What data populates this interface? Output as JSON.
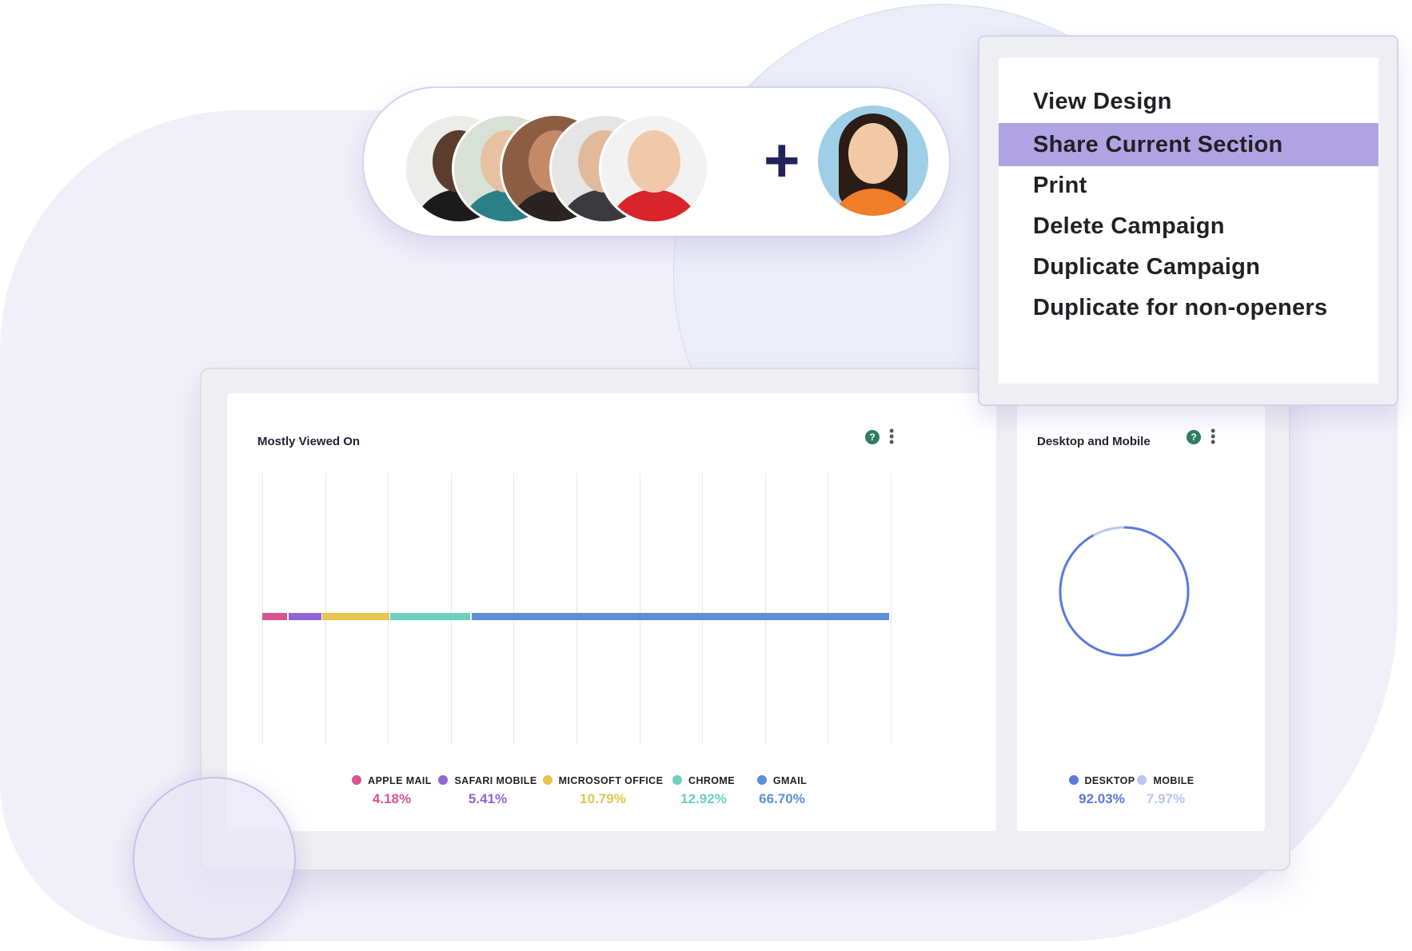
{
  "avatars": {
    "team_members": [
      {
        "name": "avatar-1",
        "skin": "#5a3d2e",
        "shirt": "#1b1b1b"
      },
      {
        "name": "avatar-2",
        "skin": "#e7c1a1",
        "shirt": "#2b7f86"
      },
      {
        "name": "avatar-3",
        "skin": "#c48a68",
        "shirt": "#2a2322"
      },
      {
        "name": "avatar-4",
        "skin": "#e1b99b",
        "shirt": "#3a3a3e"
      },
      {
        "name": "avatar-5",
        "skin": "#f0c9ab",
        "shirt": "#d8242a"
      }
    ],
    "plus_symbol": "+",
    "new_member": {
      "name": "avatar-new",
      "skin": "#f1c9a7",
      "shirt": "#ef7d2a"
    }
  },
  "context_menu": {
    "items": [
      {
        "label": "View Design",
        "active": false
      },
      {
        "label": "Share Current Section",
        "active": true
      },
      {
        "label": "Print",
        "active": false
      },
      {
        "label": "Delete Campaign",
        "active": false
      },
      {
        "label": "Duplicate Campaign",
        "active": false
      },
      {
        "label": "Duplicate for non-openers",
        "active": false
      }
    ],
    "highlight_color": "#b0a3e3"
  },
  "mostly_viewed": {
    "title": "Mostly Viewed On",
    "help_icon": "?",
    "menu_icon": "⋮"
  },
  "desktop_mobile": {
    "title": "Desktop and Mobile",
    "help_icon": "?",
    "menu_icon": "⋮"
  },
  "chart_data": [
    {
      "type": "bar",
      "title": "Mostly Viewed On",
      "stacked": true,
      "orientation": "horizontal",
      "grid": true,
      "legend": "bottom",
      "series": [
        {
          "name": "APPLE MAIL",
          "value": 4.18,
          "display": "4.18%",
          "color": "#d9548f"
        },
        {
          "name": "SAFARI MOBILE",
          "value": 5.41,
          "display": "5.41%",
          "color": "#8f65d8"
        },
        {
          "name": "MICROSOFT OFFICE",
          "value": 10.79,
          "display": "10.79%",
          "color": "#e6c44e"
        },
        {
          "name": "CHROME",
          "value": 12.92,
          "display": "12.92%",
          "color": "#6dd0bf"
        },
        {
          "name": "GMAIL",
          "value": 66.7,
          "display": "66.70%",
          "color": "#5b8fd8"
        }
      ]
    },
    {
      "type": "pie",
      "title": "Desktop and Mobile",
      "legend": "bottom",
      "series": [
        {
          "name": "DESKTOP",
          "value": 92.03,
          "display": "92.03%",
          "color": "#5d78de"
        },
        {
          "name": "MOBILE",
          "value": 7.97,
          "display": "7.97%",
          "color": "#b9c6f0"
        }
      ]
    }
  ]
}
